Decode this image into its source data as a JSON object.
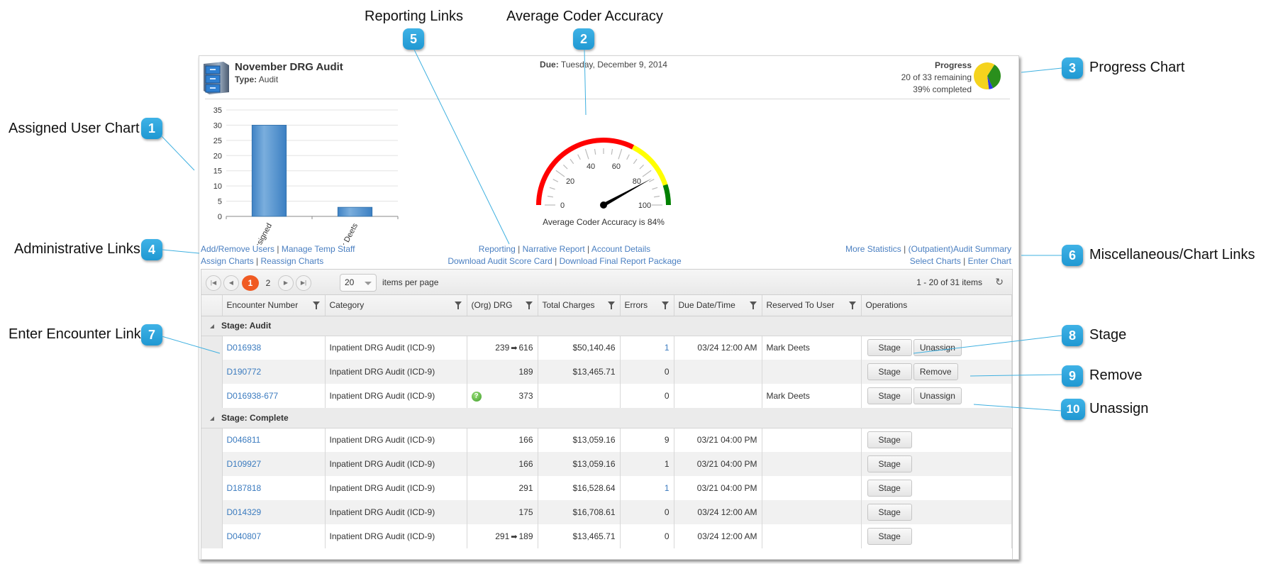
{
  "callouts": [
    {
      "num": "1",
      "label": "Assigned User Chart"
    },
    {
      "num": "2",
      "label": "Average Coder Accuracy"
    },
    {
      "num": "3",
      "label": "Progress Chart"
    },
    {
      "num": "4",
      "label": "Administrative Links"
    },
    {
      "num": "5",
      "label": "Reporting Links"
    },
    {
      "num": "6",
      "label": "Miscellaneous/Chart Links"
    },
    {
      "num": "7",
      "label": "Enter Encounter Link"
    },
    {
      "num": "8",
      "label": "Stage"
    },
    {
      "num": "9",
      "label": "Remove"
    },
    {
      "num": "10",
      "label": "Unassign"
    }
  ],
  "header": {
    "title": "November DRG Audit",
    "type_label": "Type:",
    "type_value": "Audit",
    "due_label": "Due:",
    "due_value": "Tuesday, December 9, 2014",
    "progress_title": "Progress",
    "progress_remaining": "20 of 33 remaining",
    "progress_completed": "39% completed",
    "progress_fraction_complete": 0.39,
    "progress_colors": {
      "yellow": "#f5d31d",
      "green": "#2a8f1c",
      "blue": "#2b35e8"
    }
  },
  "chart_data": [
    {
      "type": "bar",
      "title": "Assigned User Chart",
      "categories": [
        "Unassigned",
        "Mark Deets"
      ],
      "values": [
        30,
        3
      ],
      "ylim": [
        0,
        35
      ],
      "yticks": [
        0,
        5,
        10,
        15,
        20,
        25,
        30,
        35
      ],
      "xlabel": "",
      "ylabel": "",
      "grid": true,
      "color": "#4a8fd0"
    },
    {
      "type": "gauge",
      "title": "Average Coder Accuracy",
      "value": 84,
      "range": [
        0,
        100
      ],
      "ticks": [
        0,
        20,
        40,
        60,
        80,
        100
      ],
      "bands": [
        {
          "from": 0,
          "to": 65,
          "color": "#ff0000"
        },
        {
          "from": 65,
          "to": 90,
          "color": "#ffff00"
        },
        {
          "from": 90,
          "to": 100,
          "color": "#008000"
        }
      ],
      "caption": "Average Coder Accuracy is 84%"
    }
  ],
  "links": {
    "admin": [
      [
        "Add/Remove Users",
        "Manage Temp Staff"
      ],
      [
        "Assign Charts",
        "Reassign Charts"
      ]
    ],
    "reporting": [
      [
        "Reporting",
        "Narrative Report",
        "Account Details"
      ],
      [
        "Download Audit Score Card",
        "Download Final Report Package"
      ]
    ],
    "misc": [
      [
        "More Statistics",
        "(Outpatient)Audit Summary"
      ],
      [
        "Select Charts",
        "Enter Chart"
      ]
    ],
    "separator": "|"
  },
  "pager": {
    "pages": [
      "1",
      "2"
    ],
    "current": "1",
    "page_size": "20",
    "page_size_label": "items per page",
    "info": "1 - 20 of 31 items"
  },
  "columns": [
    "Encounter Number",
    "Category",
    "(Org) DRG",
    "Total Charges",
    "Errors",
    "Due Date/Time",
    "Reserved To User",
    "Operations"
  ],
  "groups": [
    {
      "label": "Stage: Audit",
      "rows": [
        {
          "encounter": "D016938",
          "category": "Inpatient DRG Audit (ICD-9)",
          "drg_from": "239",
          "drg_to": "616",
          "charges": "$50,140.46",
          "errors": "1",
          "errors_link": true,
          "due": "03/24 12:00 AM",
          "reserved": "Mark Deets",
          "ops": [
            "Stage",
            "Unassign"
          ],
          "question": false
        },
        {
          "encounter": "D190772",
          "category": "Inpatient DRG Audit (ICD-9)",
          "drg_from": "",
          "drg_to": "189",
          "charges": "$13,465.71",
          "errors": "0",
          "errors_link": false,
          "due": "",
          "reserved": "",
          "ops": [
            "Stage",
            "Remove"
          ],
          "question": false
        },
        {
          "encounter": "D016938-677",
          "category": "Inpatient DRG Audit (ICD-9)",
          "drg_from": "",
          "drg_to": "373",
          "charges": "",
          "errors": "0",
          "errors_link": false,
          "due": "",
          "reserved": "Mark Deets",
          "ops": [
            "Stage",
            "Unassign"
          ],
          "question": true
        }
      ]
    },
    {
      "label": "Stage: Complete",
      "rows": [
        {
          "encounter": "D046811",
          "category": "Inpatient DRG Audit (ICD-9)",
          "drg_from": "",
          "drg_to": "166",
          "charges": "$13,059.16",
          "errors": "9",
          "errors_link": false,
          "due": "03/21 04:00 PM",
          "reserved": "",
          "ops": [
            "Stage"
          ],
          "question": false
        },
        {
          "encounter": "D109927",
          "category": "Inpatient DRG Audit (ICD-9)",
          "drg_from": "",
          "drg_to": "166",
          "charges": "$13,059.16",
          "errors": "1",
          "errors_link": false,
          "due": "03/21 04:00 PM",
          "reserved": "",
          "ops": [
            "Stage"
          ],
          "question": false
        },
        {
          "encounter": "D187818",
          "category": "Inpatient DRG Audit (ICD-9)",
          "drg_from": "",
          "drg_to": "291",
          "charges": "$16,528.64",
          "errors": "1",
          "errors_link": true,
          "due": "03/21 04:00 PM",
          "reserved": "",
          "ops": [
            "Stage"
          ],
          "question": false
        },
        {
          "encounter": "D014329",
          "category": "Inpatient DRG Audit (ICD-9)",
          "drg_from": "",
          "drg_to": "175",
          "charges": "$16,708.61",
          "errors": "0",
          "errors_link": false,
          "due": "03/24 12:00 AM",
          "reserved": "",
          "ops": [
            "Stage"
          ],
          "question": false
        },
        {
          "encounter": "D040807",
          "category": "Inpatient DRG Audit (ICD-9)",
          "drg_from": "291",
          "drg_to": "189",
          "charges": "$13,465.71",
          "errors": "0",
          "errors_link": false,
          "due": "03/24 12:00 AM",
          "reserved": "",
          "ops": [
            "Stage"
          ],
          "question": false
        }
      ]
    }
  ],
  "icons": {
    "drg_arrow": "➡",
    "question": "?",
    "refresh": "↻",
    "group_toggle": "triangle-collapse-icon"
  }
}
